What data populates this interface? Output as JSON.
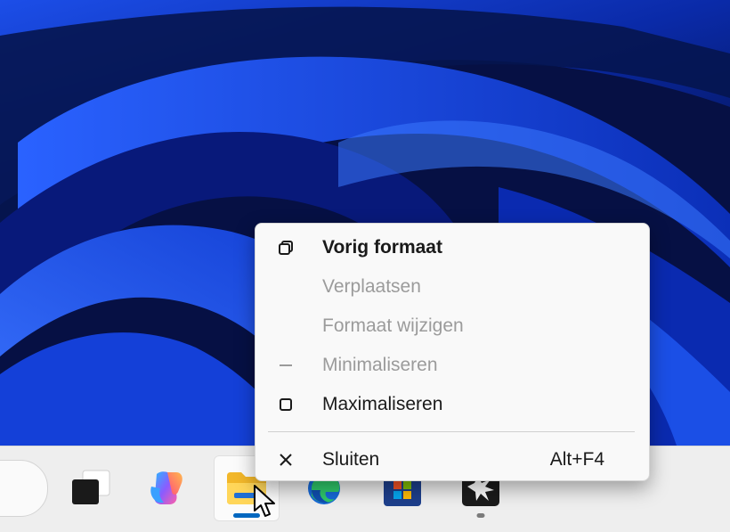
{
  "context_menu": {
    "items": [
      {
        "label": "Vorig formaat",
        "icon": "restore-icon",
        "enabled": true,
        "bold": true
      },
      {
        "label": "Verplaatsen",
        "icon": "",
        "enabled": false
      },
      {
        "label": "Formaat wijzigen",
        "icon": "",
        "enabled": false
      },
      {
        "label": "Minimaliseren",
        "icon": "minimize-icon",
        "enabled": false
      },
      {
        "label": "Maximaliseren",
        "icon": "maximize-icon",
        "enabled": true
      }
    ],
    "close": {
      "label": "Sluiten",
      "shortcut": "Alt+F4",
      "icon": "close-icon"
    }
  },
  "taskbar": {
    "items": [
      "search-box",
      "task-view-icon",
      "copilot-icon",
      "file-explorer-icon",
      "edge-icon",
      "microsoft-store-icon",
      "app-icon"
    ],
    "active": "file-explorer-icon"
  },
  "colors": {
    "wallpaper_dark": "#050c3a",
    "wallpaper_blue": "#1f4fe0",
    "taskbar": "#eeeeee",
    "menu": "#f9f9f9",
    "accent": "#0067c0"
  }
}
